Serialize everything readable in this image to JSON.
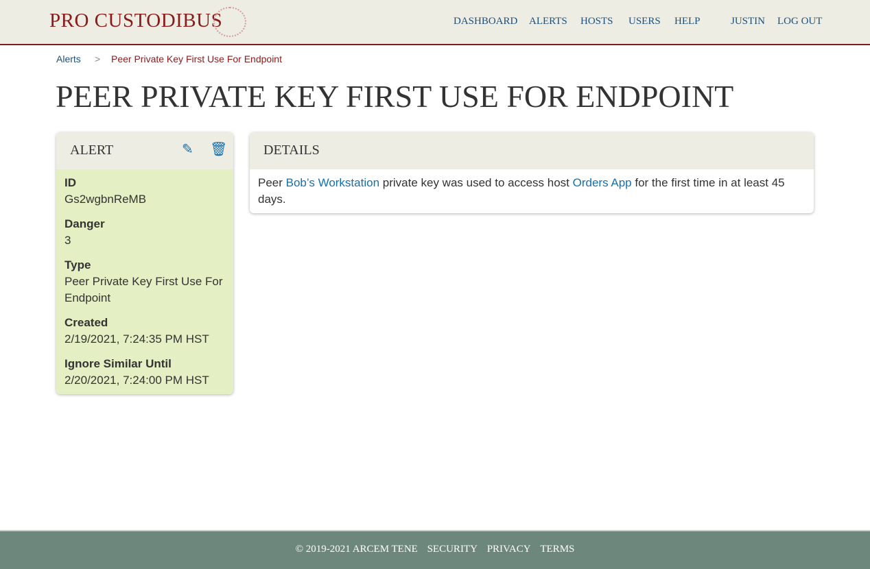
{
  "brand": "PRO CUSTODIBUS",
  "nav": [
    "DASHBOARD",
    "ALERTS",
    "HOSTS",
    "USERS",
    "HELP",
    "JUSTIN",
    "LOG OUT"
  ],
  "breadcrumb": {
    "parent": "Alerts",
    "sep": ">",
    "current": "Peer Private Key First Use For Endpoint"
  },
  "title": "PEER PRIVATE KEY FIRST USE FOR ENDPOINT",
  "alert": {
    "heading": "ALERT",
    "fields": [
      {
        "label": "ID",
        "value": "Gs2wgbnReMB"
      },
      {
        "label": "Danger",
        "value": "3"
      },
      {
        "label": "Type",
        "value": "Peer Private Key First Use For Endpoint"
      },
      {
        "label": "Created",
        "value": "2/19/2021, 7:24:35 PM HST"
      },
      {
        "label": "Ignore Similar Until",
        "value": "2/20/2021, 7:24:00 PM HST"
      }
    ]
  },
  "details": {
    "heading": "DETAILS",
    "t1": "Peer ",
    "peer": "Bob’s Workstation",
    "t2": " private key was used to access host ",
    "host": "Orders App",
    "t3": " for the first time in at least 45 days."
  },
  "footer": [
    "© 2019-2021 ARCEM TENE",
    "SECURITY",
    "PRIVACY",
    "TERMS"
  ]
}
